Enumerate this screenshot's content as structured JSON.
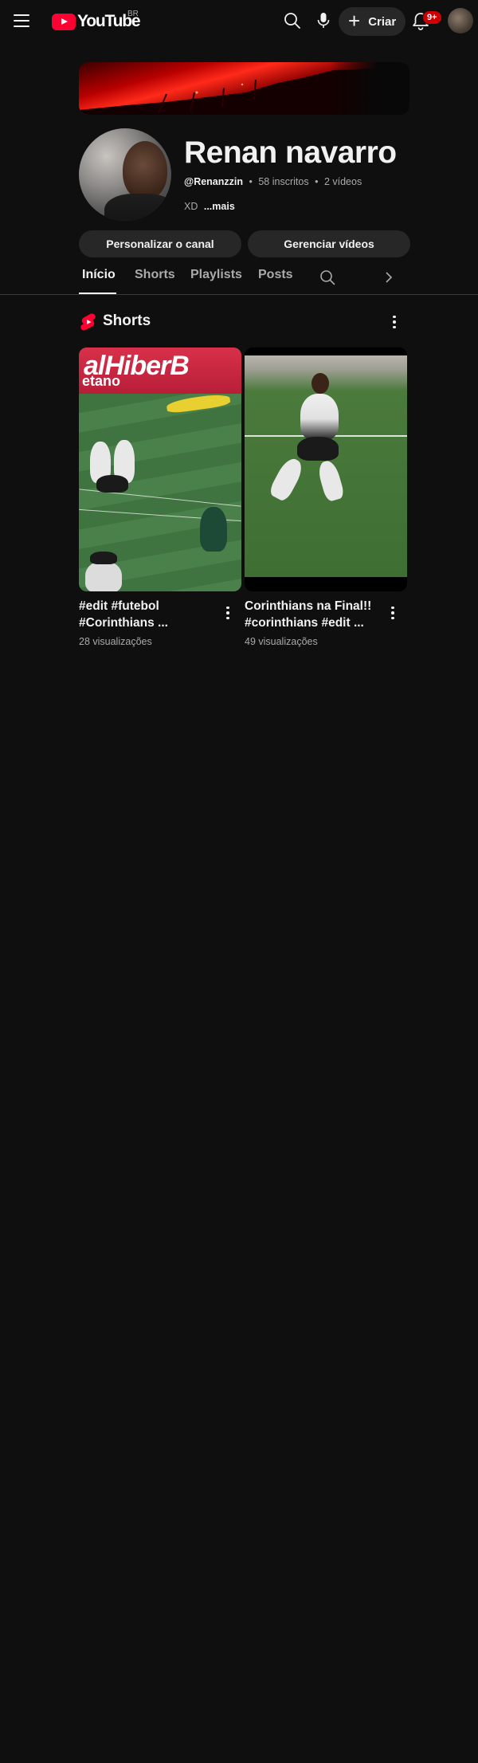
{
  "header": {
    "logo_text": "YouTube",
    "country_code": "BR",
    "create_label": "Criar",
    "notification_count": "9+"
  },
  "channel": {
    "name": "Renan navarro",
    "handle": "@Renanzzin",
    "subscribers": "58 inscritos",
    "videos": "2 vídeos",
    "separator": "•",
    "description": "XD",
    "more_label": "...mais",
    "customize_label": "Personalizar o canal",
    "manage_label": "Gerenciar vídeos"
  },
  "tabs": {
    "home": "Início",
    "shorts": "Shorts",
    "playlists": "Playlists",
    "posts": "Posts"
  },
  "section": {
    "title": "Shorts"
  },
  "shorts": [
    {
      "title_line1": "#edit #futebol",
      "title_line2": "#Corinthians ...",
      "views": "28 visualizações",
      "thumb_text1": "alHiberB",
      "thumb_text2": "etano"
    },
    {
      "title_line1": "Corinthians na Final!!",
      "title_line2": "#corinthians #edit ...",
      "views": "49 visualizações"
    }
  ],
  "colors": {
    "background": "#0f0f0f",
    "brand_red": "#ff0033",
    "badge_red": "#cc0000",
    "button_bg": "#272727"
  }
}
